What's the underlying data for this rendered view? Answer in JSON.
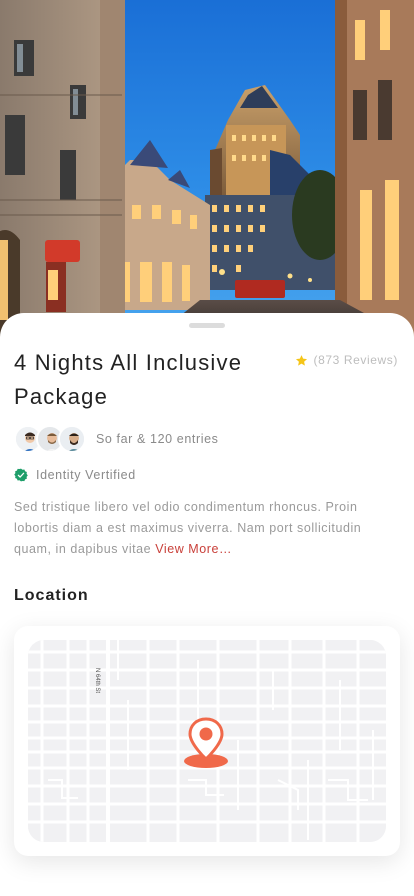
{
  "hero": {
    "image_description": ""
  },
  "listing": {
    "title": "4 Nights All Inclusive Package",
    "reviews": "(873 Reviews)",
    "entries": "So far & 120 entries",
    "verified": "Identity Vertified",
    "description": "Sed tristique libero vel odio condimentum rhoncus. Proin lobortis diam a est maximus viverra. Nam port sollicitudin quam, in dapibus vitae ",
    "view_more": "View More…"
  },
  "location": {
    "title": "Location",
    "street": "N 64th St"
  },
  "colors": {
    "accent": "#f0694a",
    "link": "#c9403a",
    "star": "#f5c518",
    "verified": "#1e9e6a"
  },
  "icons": [
    "star-icon",
    "verified-check-icon",
    "map-pin-icon"
  ]
}
